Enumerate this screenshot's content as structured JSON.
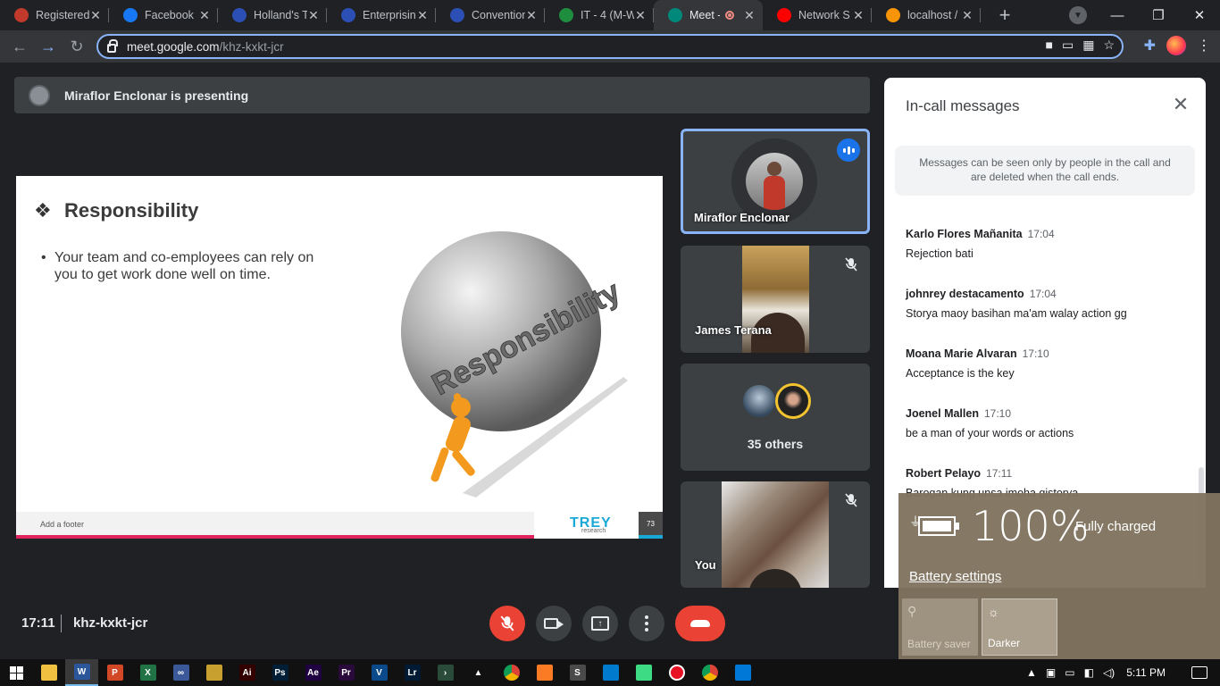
{
  "browser": {
    "tabs": [
      {
        "label": "Registered",
        "icon": "registered-favicon",
        "color": "#c0392b"
      },
      {
        "label": "Facebook",
        "icon": "facebook-favicon",
        "color": "#1877f2"
      },
      {
        "label": "Holland's T",
        "icon": "slideshare-favicon",
        "color": "#2b4fb5"
      },
      {
        "label": "Enterprisin",
        "icon": "slideshare-favicon",
        "color": "#2b4fb5"
      },
      {
        "label": "Convention",
        "icon": "slideshare-favicon",
        "color": "#2b4fb5"
      },
      {
        "label": "IT - 4 (M-W",
        "icon": "classroom-favicon",
        "color": "#1e8e3e"
      },
      {
        "label": "Meet -",
        "icon": "meet-favicon",
        "color": "#00897b",
        "active": true
      },
      {
        "label": "Network S",
        "icon": "youtube-favicon",
        "color": "#ff0000"
      },
      {
        "label": "localhost /",
        "icon": "phpmyadmin-favicon",
        "color": "#f89406"
      }
    ],
    "url_host": "meet.google.com",
    "url_path": "/khz-kxkt-jcr"
  },
  "meet": {
    "presenting_text": "Miraflor Enclonar is presenting",
    "slide": {
      "bullet_glyph": "❖",
      "title": "Responsibility",
      "body_bullet": "•",
      "body": "Your team and co-employees can rely on you to get work done well on time.",
      "ball_text": "Responsibility",
      "footer": "Add a footer",
      "logo": "TREY",
      "logo_sub": "research",
      "page_number": "73"
    },
    "tiles": [
      {
        "name": "Miraflor Enclonar",
        "speaking": true
      },
      {
        "name": "James Terana",
        "muted": true
      },
      {
        "name": "35 others"
      },
      {
        "name": "You",
        "muted": true
      }
    ],
    "time": "17:11",
    "meeting_code": "khz-kxkt-jcr"
  },
  "messages": {
    "title": "In-call messages",
    "notice": "Messages can be seen only by people in the call and are deleted when the call ends.",
    "items": [
      {
        "sender": "Karlo Flores Mañanita",
        "time": "17:04",
        "text": "Rejection bati"
      },
      {
        "sender": "johnrey destacamento",
        "time": "17:04",
        "text": "Storya maoy basihan ma'am walay action gg"
      },
      {
        "sender": "Moana Marie Alvaran",
        "time": "17:10",
        "text": "Acceptance is the key"
      },
      {
        "sender": "Joenel Mallen",
        "time": "17:10",
        "text": "be a man of your words or actions"
      },
      {
        "sender": "Robert Pelayo",
        "time": "17:11",
        "text": "Barogan kung unsa imoha gistorya"
      }
    ]
  },
  "battery": {
    "percent": "100%",
    "status": "Fully charged",
    "settings_link": "Battery settings",
    "saver_label": "Battery saver",
    "darker_label": "Darker"
  },
  "taskbar": {
    "apps": [
      {
        "name": "file-explorer",
        "label": "",
        "color": "#f0c040"
      },
      {
        "name": "word",
        "label": "W",
        "color": "#2b579a",
        "active": true
      },
      {
        "name": "powerpoint",
        "label": "P",
        "color": "#d24726"
      },
      {
        "name": "excel",
        "label": "X",
        "color": "#217346"
      },
      {
        "name": "infinity-app",
        "label": "∞",
        "color": "#3b5998"
      },
      {
        "name": "paint-app",
        "label": "",
        "color": "#c8a030"
      },
      {
        "name": "illustrator",
        "label": "Ai",
        "color": "#330000"
      },
      {
        "name": "photoshop",
        "label": "Ps",
        "color": "#001e36"
      },
      {
        "name": "after-effects",
        "label": "Ae",
        "color": "#1f0040"
      },
      {
        "name": "premiere",
        "label": "Pr",
        "color": "#2a0a3a"
      },
      {
        "name": "vegas",
        "label": "V",
        "color": "#0a4a8a"
      },
      {
        "name": "lightroom",
        "label": "Lr",
        "color": "#001a33"
      },
      {
        "name": "terminal-app",
        "label": "›",
        "color": "#2a4a3a"
      },
      {
        "name": "vlc",
        "label": "▲",
        "color": "#111111"
      },
      {
        "name": "chrome",
        "label": "",
        "color": "#db4437"
      },
      {
        "name": "xampp",
        "label": "",
        "color": "#fb7a24"
      },
      {
        "name": "sublime",
        "label": "S",
        "color": "#4a4a4a"
      },
      {
        "name": "vscode",
        "label": "",
        "color": "#007acc"
      },
      {
        "name": "android-app",
        "label": "",
        "color": "#3ddc84"
      },
      {
        "name": "recorder",
        "label": "",
        "color": "#e81123"
      },
      {
        "name": "chrome-active",
        "label": "",
        "color": "#db4437"
      },
      {
        "name": "photos-app",
        "label": "",
        "color": "#0078d7"
      }
    ],
    "clock": "5:11 PM"
  }
}
